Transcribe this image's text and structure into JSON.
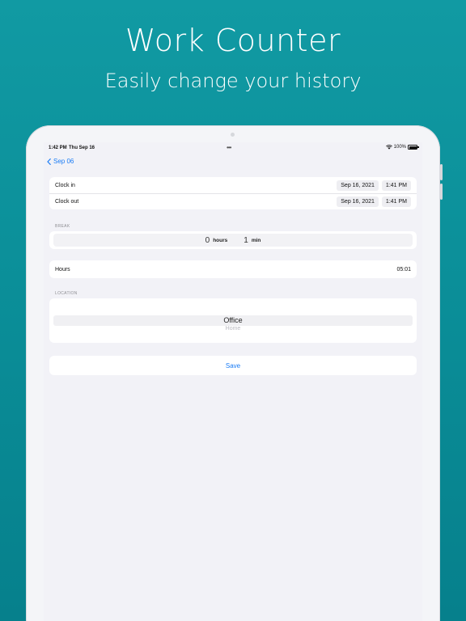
{
  "marketing": {
    "headline": "Work Counter",
    "subline": "Easily change your history"
  },
  "statusbar": {
    "time": "1:42 PM",
    "date": "Thu Sep 16",
    "dots": "•••",
    "battery": "100%"
  },
  "navbar": {
    "back_label": "Sep 06",
    "back_icon": "chevron-left-icon"
  },
  "times": {
    "clock_in": {
      "label": "Clock in",
      "date": "Sep 16, 2021",
      "time": "1:41 PM"
    },
    "clock_out": {
      "label": "Clock out",
      "date": "Sep 16, 2021",
      "time": "1:41 PM"
    }
  },
  "break": {
    "section_label": "BREAK",
    "hours_value": "0",
    "hours_unit": "hours",
    "minutes_value": "1",
    "minutes_unit": "min"
  },
  "hours": {
    "label": "Hours",
    "value": "05:01"
  },
  "location": {
    "section_label": "LOCATION",
    "selected": "Office",
    "next": "Home"
  },
  "actions": {
    "save_label": "Save"
  },
  "colors": {
    "accent": "#1a7cf5",
    "background": "#0b8f99"
  }
}
